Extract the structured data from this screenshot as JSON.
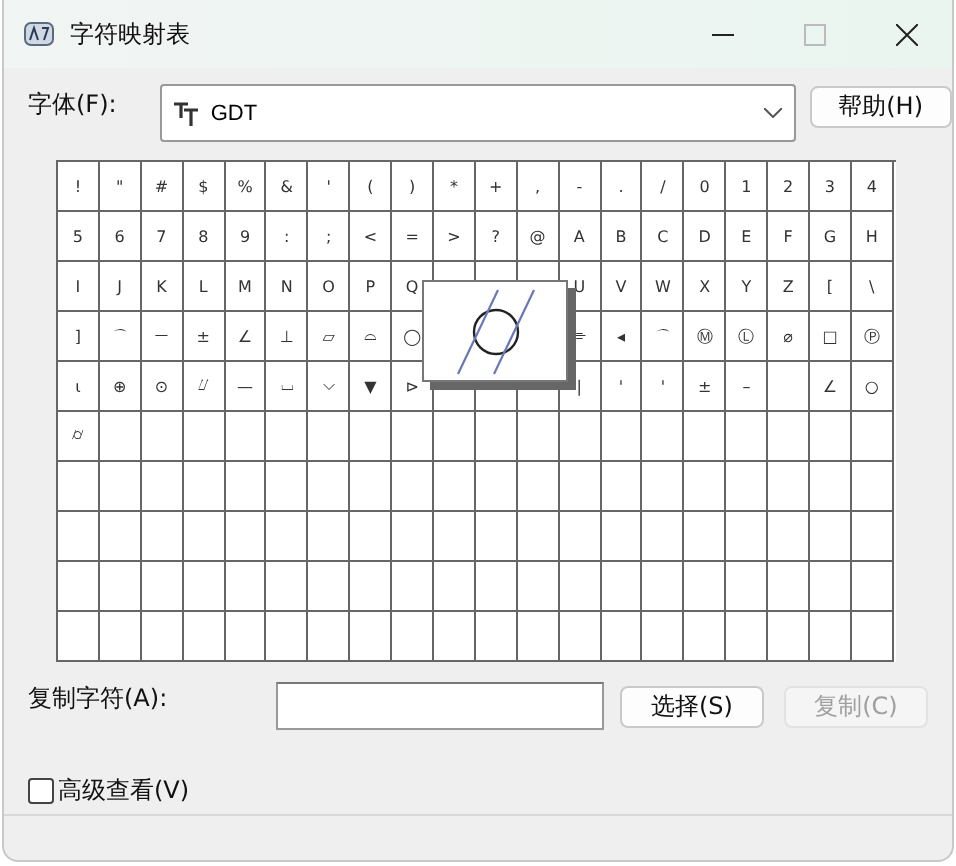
{
  "window": {
    "title": "字符映射表"
  },
  "font": {
    "label": "字体(F):",
    "value": "GDT"
  },
  "help_button": "帮助(H)",
  "grid": {
    "rows": [
      [
        {
          "char": "!"
        },
        {
          "char": "\""
        },
        {
          "char": "#"
        },
        {
          "char": "$"
        },
        {
          "char": "%"
        },
        {
          "char": "&"
        },
        {
          "char": "'"
        },
        {
          "char": "("
        },
        {
          "char": ")"
        },
        {
          "char": "*"
        },
        {
          "char": "+"
        },
        {
          "char": ","
        },
        {
          "char": "-"
        },
        {
          "char": "."
        },
        {
          "char": "/"
        },
        {
          "char": "0"
        },
        {
          "char": "1"
        },
        {
          "char": "2"
        },
        {
          "char": "3"
        },
        {
          "char": "4"
        }
      ],
      [
        {
          "char": "5"
        },
        {
          "char": "6"
        },
        {
          "char": "7"
        },
        {
          "char": "8"
        },
        {
          "char": "9"
        },
        {
          "char": ":"
        },
        {
          "char": ";"
        },
        {
          "char": "<"
        },
        {
          "char": "="
        },
        {
          "char": ">"
        },
        {
          "char": "?"
        },
        {
          "char": "@"
        },
        {
          "char": "A"
        },
        {
          "char": "B"
        },
        {
          "char": "C"
        },
        {
          "char": "D"
        },
        {
          "char": "E"
        },
        {
          "char": "F"
        },
        {
          "char": "G"
        },
        {
          "char": "H"
        }
      ],
      [
        {
          "char": "I"
        },
        {
          "char": "J"
        },
        {
          "char": "K"
        },
        {
          "char": "L"
        },
        {
          "char": "M"
        },
        {
          "char": "N"
        },
        {
          "char": "O"
        },
        {
          "char": "P"
        },
        {
          "char": "Q"
        },
        {},
        {},
        {},
        {
          "char": "U"
        },
        {
          "char": "V"
        },
        {
          "char": "W"
        },
        {
          "char": "X"
        },
        {
          "char": "Y"
        },
        {
          "char": "Z"
        },
        {
          "char": "["
        },
        {
          "char": "\\"
        }
      ],
      [
        {
          "char": "]"
        },
        {
          "char": "⌒"
        },
        {
          "char": "⏤"
        },
        {
          "char": "±"
        },
        {
          "char": "∠"
        },
        {
          "char": "⊥"
        },
        {
          "char": "⏥"
        },
        {
          "char": "⌓"
        },
        {
          "char": "◯"
        },
        {},
        {},
        {},
        {
          "char": "⌯"
        },
        {
          "char": "◂"
        },
        {
          "char": "⌒"
        },
        {
          "char": "Ⓜ"
        },
        {
          "char": "Ⓛ"
        },
        {
          "char": "⌀"
        },
        {
          "char": "□"
        },
        {
          "char": "Ⓟ"
        }
      ],
      [
        {
          "char": "ɩ"
        },
        {
          "char": "⊕"
        },
        {
          "char": "⊙"
        },
        {
          "char": "⌰"
        },
        {
          "char": "—"
        },
        {
          "char": "⌴"
        },
        {
          "char": "⌵"
        },
        {
          "char": "▼"
        },
        {
          "char": "⊳"
        },
        {},
        {},
        {},
        {
          "char": "|"
        },
        {
          "char": "'"
        },
        {
          "char": "'"
        },
        {
          "char": "±"
        },
        {
          "char": "–"
        },
        {},
        {
          "char": "∠"
        },
        {
          "char": "○"
        }
      ],
      [
        {
          "char": "⌭"
        },
        {},
        {},
        {},
        {},
        {},
        {},
        {},
        {},
        {},
        {},
        {},
        {},
        {},
        {},
        {},
        {},
        {},
        {},
        {}
      ],
      [
        {},
        {},
        {},
        {},
        {},
        {},
        {},
        {},
        {},
        {},
        {},
        {},
        {},
        {},
        {},
        {},
        {},
        {},
        {},
        {}
      ],
      [
        {},
        {},
        {},
        {},
        {},
        {},
        {},
        {},
        {},
        {},
        {},
        {},
        {},
        {},
        {},
        {},
        {},
        {},
        {},
        {}
      ],
      [
        {},
        {},
        {},
        {},
        {},
        {},
        {},
        {},
        {},
        {},
        {},
        {},
        {},
        {},
        {},
        {},
        {},
        {},
        {},
        {}
      ],
      [
        {},
        {},
        {},
        {},
        {},
        {},
        {},
        {},
        {},
        {},
        {},
        {},
        {},
        {},
        {},
        {},
        {},
        {},
        {},
        {}
      ]
    ]
  },
  "preview": {
    "visible": true
  },
  "copy": {
    "label": "复制字符(A):",
    "select_button": "选择(S)",
    "copy_button": "复制(C)",
    "copy_disabled": true
  },
  "advanced": {
    "label": "高级查看(V)",
    "checked": false
  }
}
